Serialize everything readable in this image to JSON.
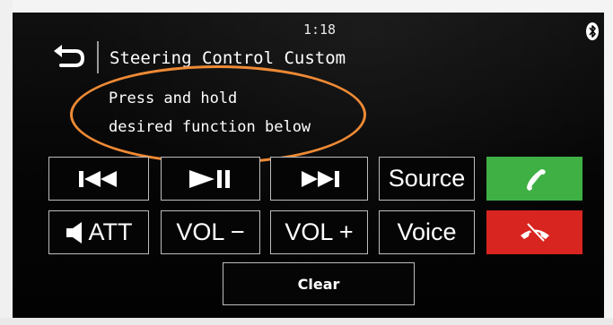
{
  "status_bar": {
    "time": "1:18",
    "bluetooth_icon": "bluetooth-icon"
  },
  "header": {
    "back_icon": "back-arrow-icon",
    "title": "Steering Control Custom"
  },
  "instructions": {
    "line1": "Press and hold",
    "line2": "desired function below"
  },
  "buttons": {
    "row1": [
      {
        "name": "previous-track-button",
        "icon": "skip-back-icon"
      },
      {
        "name": "play-pause-button",
        "icon": "play-pause-icon"
      },
      {
        "name": "next-track-button",
        "icon": "skip-forward-icon"
      },
      {
        "name": "source-button",
        "label": "Source"
      },
      {
        "name": "call-accept-button",
        "icon": "phone-icon",
        "color": "#3fb044"
      }
    ],
    "row2": [
      {
        "name": "att-button",
        "label": "ATT",
        "icon": "speaker-icon"
      },
      {
        "name": "volume-down-button",
        "label": "VOL −"
      },
      {
        "name": "volume-up-button",
        "label": "VOL +"
      },
      {
        "name": "voice-button",
        "label": "Voice"
      },
      {
        "name": "call-reject-button",
        "icon": "hang-up-icon",
        "color": "#d8251f"
      }
    ],
    "clear": {
      "label": "Clear"
    }
  },
  "colors": {
    "highlight_ring": "#ee8a35",
    "accept": "#3fb044",
    "reject": "#d8251f",
    "background": "#050505"
  }
}
